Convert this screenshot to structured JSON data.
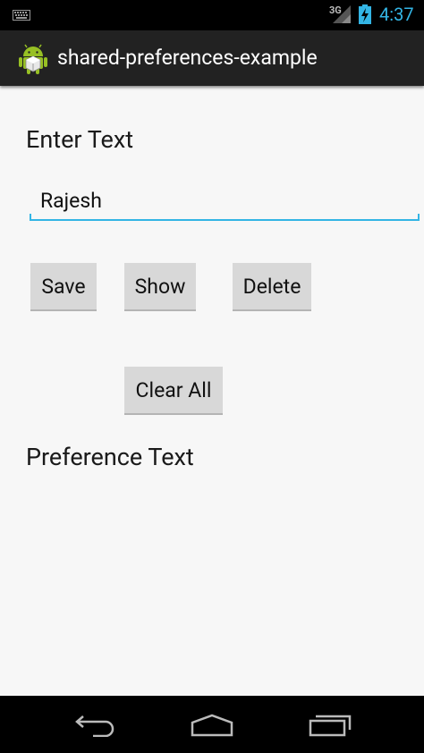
{
  "status_bar": {
    "network": "3G",
    "time": "4:37"
  },
  "action_bar": {
    "title": "shared-preferences-example"
  },
  "form": {
    "enter_label": "Enter Text",
    "input_value": "Rajesh",
    "save_label": "Save",
    "show_label": "Show",
    "delete_label": "Delete",
    "clear_all_label": "Clear All",
    "preference_label": "Preference Text"
  },
  "colors": {
    "accent": "#33b5e5",
    "action_bar": "#222222",
    "background": "#f7f7f7"
  },
  "nav_bar": {
    "icons": [
      "back-icon",
      "home-icon",
      "recents-icon"
    ]
  }
}
